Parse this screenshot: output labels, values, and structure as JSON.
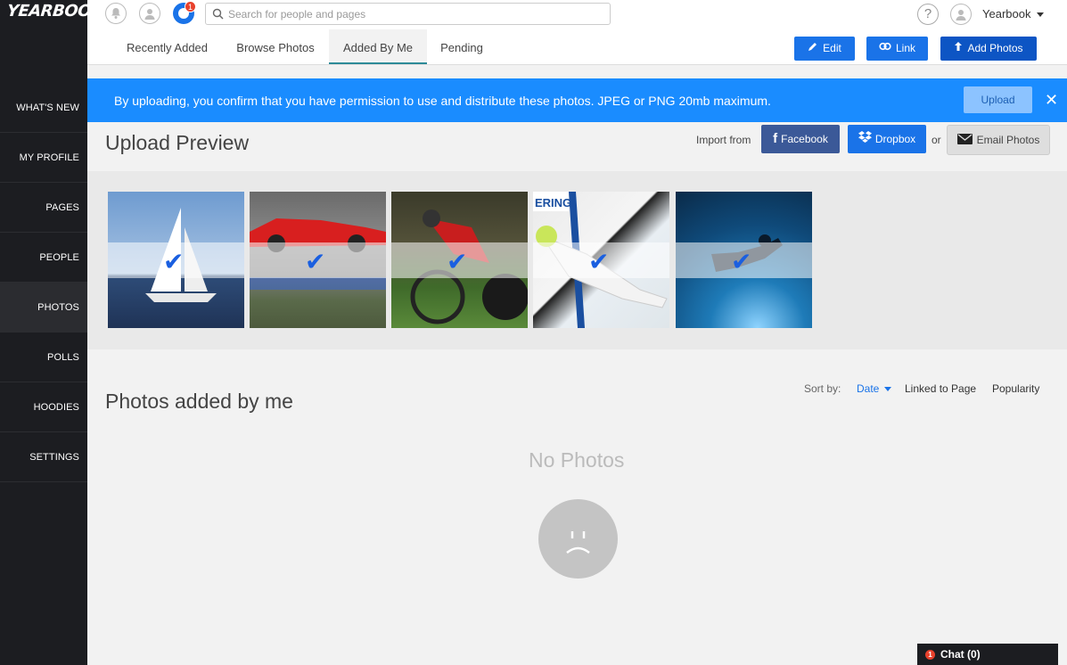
{
  "app": {
    "logo_text": "YEARBOOK"
  },
  "topbar": {
    "notification_count": "1",
    "search_placeholder": "Search for people and pages",
    "help_label": "?",
    "user_name": "Yearbook"
  },
  "sidebar": {
    "items": [
      {
        "label": "WHAT'S NEW"
      },
      {
        "label": "MY PROFILE"
      },
      {
        "label": "PAGES"
      },
      {
        "label": "PEOPLE"
      },
      {
        "label": "PHOTOS"
      },
      {
        "label": "POLLS"
      },
      {
        "label": "HOODIES"
      },
      {
        "label": "SETTINGS"
      }
    ],
    "active": "PHOTOS"
  },
  "tabs": [
    {
      "label": "Recently Added"
    },
    {
      "label": "Browse Photos"
    },
    {
      "label": "Added By Me"
    },
    {
      "label": "Pending"
    }
  ],
  "active_tab": "Added By Me",
  "actions": {
    "edit": "Edit",
    "link": "Link",
    "add_photos": "Add Photos"
  },
  "banner": {
    "text": "By uploading, you confirm that you have permission to use and distribute these photos. JPEG or PNG 20mb maximum.",
    "upload_button": "Upload",
    "close": "✕"
  },
  "upload_preview": {
    "title": "Upload Preview",
    "import_label": "Import from",
    "facebook": "Facebook",
    "dropbox": "Dropbox",
    "or": "or",
    "email": "Email Photos",
    "check_mark": "✔",
    "thumbnails": [
      "sailboat",
      "race-car",
      "cyclist",
      "skier",
      "diver"
    ]
  },
  "photos_added": {
    "title": "Photos added by me",
    "sort_label": "Sort by:",
    "sort_options": [
      {
        "label": "Date"
      },
      {
        "label": "Linked to Page"
      },
      {
        "label": "Popularity"
      }
    ],
    "empty_text": "No Photos"
  },
  "chat": {
    "count_badge": "1",
    "label": "Chat (0)"
  },
  "colors": {
    "primary_blue": "#1a73e8",
    "banner_blue": "#1a8cff",
    "facebook": "#3b5998",
    "sidebar": "#1c1d21"
  }
}
